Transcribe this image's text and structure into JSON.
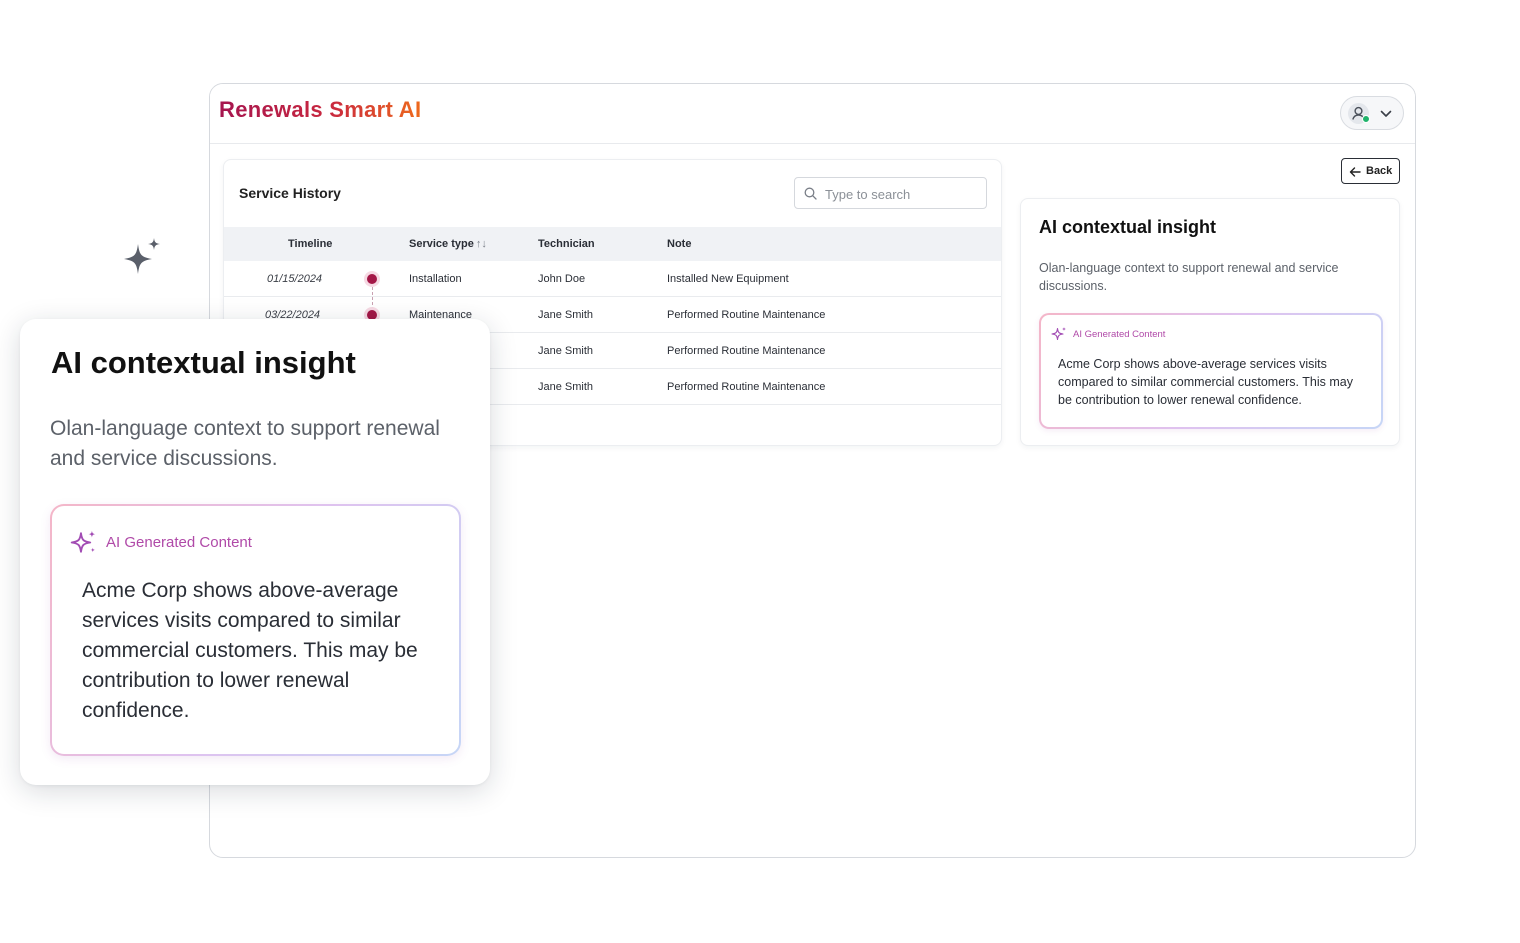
{
  "app": {
    "brand": "Renewals Smart AI"
  },
  "header": {
    "user_icon": "user-avatar-icon",
    "menu_icon": "chevron-down-icon",
    "status_color": "#1fb36b"
  },
  "service_history": {
    "title": "Service History",
    "search": {
      "placeholder": "Type to search",
      "value": ""
    },
    "columns": {
      "timeline": "Timeline",
      "service_type": "Service type",
      "sort_indicator": "↑↓",
      "technician": "Technician",
      "note": "Note"
    },
    "rows": [
      {
        "date": "01/15/2024",
        "service_type": "Installation",
        "technician": "John Doe",
        "note": "Installed New Equipment"
      },
      {
        "date": "03/22/2024",
        "service_type": "Maintenance",
        "technician": "Jane Smith",
        "note": "Performed Routine Maintenance"
      },
      {
        "date": "",
        "service_type": "",
        "technician": "Jane Smith",
        "note": "Performed Routine Maintenance"
      },
      {
        "date": "",
        "service_type": "",
        "technician": "Jane Smith",
        "note": "Performed Routine Maintenance"
      }
    ]
  },
  "back_button": {
    "label": "Back",
    "icon": "arrow-left-icon"
  },
  "insight": {
    "title": "AI contextual insight",
    "subtitle": "Olan-language context to support renewal and service discussions.",
    "ai_label": "AI Generated Content",
    "ai_text": "Acme Corp shows above-average services visits compared to similar commercial customers. This may be contribution to lower renewal confidence."
  },
  "colors": {
    "brand_start": "#a5154f",
    "brand_end": "#ee6a1c",
    "timeline_dot": "#a31646",
    "ai_accent": "#b04aa8"
  }
}
